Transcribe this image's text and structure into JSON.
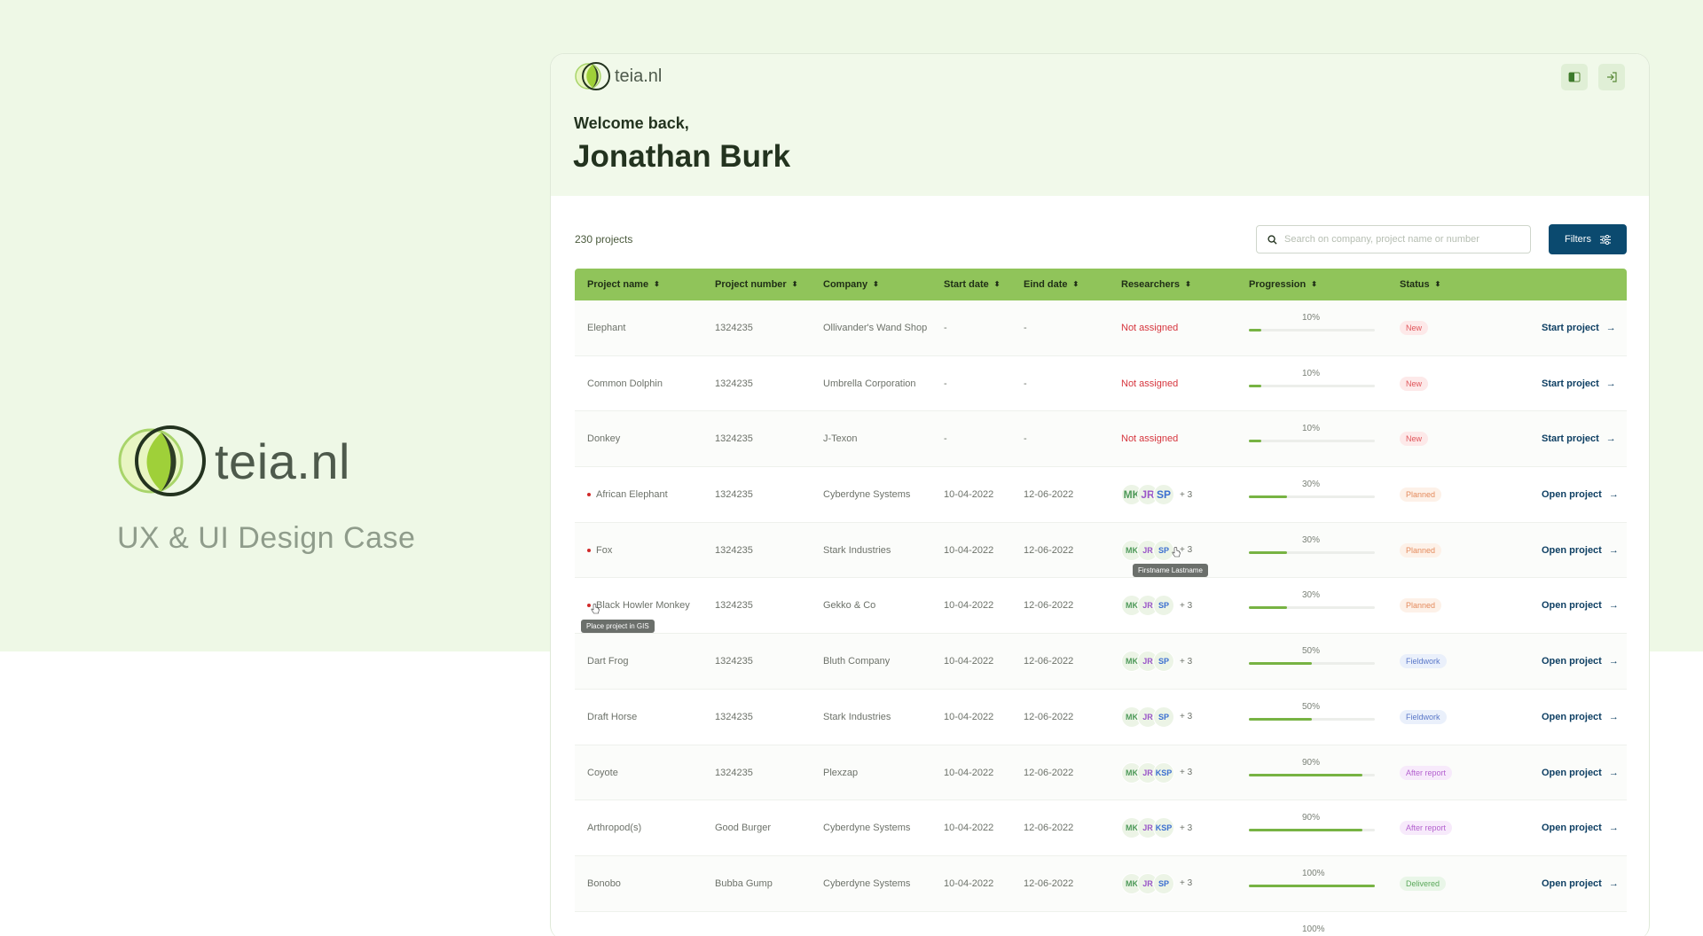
{
  "brand": {
    "name": "teia.nl",
    "subtitle": "UX & UI Design Case"
  },
  "app": {
    "logo_text": "teia.nl",
    "welcome": "Welcome back,",
    "user_name": "Jonathan Burk",
    "project_count": "230 projects",
    "search": {
      "placeholder": "Search on company, project name or number"
    },
    "filters_label": "Filters",
    "colors": {
      "header_bg": "#90c45a",
      "primary_button": "#0b4a6f",
      "progress": "#77b343",
      "not_assigned": "#d6353d"
    }
  },
  "table": {
    "columns": [
      "Project name",
      "Project number",
      "Company",
      "Start date",
      "Eind date",
      "Researchers",
      "Progression",
      "Status"
    ],
    "rows": [
      {
        "name": "Elephant",
        "number": "1324235",
        "company": "Ollivander's Wand Shop",
        "start": "-",
        "end": "-",
        "researchers": "Not assigned",
        "progress_label": "10%",
        "progress": 0.1,
        "status": "New",
        "status_type": "new",
        "action": "Start project",
        "dot": false
      },
      {
        "name": "Common Dolphin",
        "number": "1324235",
        "company": "Umbrella Corporation",
        "start": "-",
        "end": "-",
        "researchers": "Not assigned",
        "progress_label": "10%",
        "progress": 0.1,
        "status": "New",
        "status_type": "new",
        "action": "Start project",
        "dot": false
      },
      {
        "name": "Donkey",
        "number": "1324235",
        "company": "J-Texon",
        "start": "-",
        "end": "-",
        "researchers": "Not assigned",
        "progress_label": "10%",
        "progress": 0.1,
        "status": "New",
        "status_type": "new",
        "action": "Start project",
        "dot": false
      },
      {
        "name": "African Elephant",
        "number": "1324235",
        "company": "Cyberdyne Systems",
        "start": "10-04-2022",
        "end": "12-06-2022",
        "avatars": [
          "MK",
          "JR",
          "SP"
        ],
        "more": "+ 3",
        "progress_label": "30%",
        "progress": 0.3,
        "status": "Planned",
        "status_type": "planned",
        "action": "Open project",
        "dot": true
      },
      {
        "name": "Fox",
        "number": "1324235",
        "company": "Stark Industries",
        "start": "10-04-2022",
        "end": "12-06-2022",
        "avatars": [
          "MK",
          "JR",
          "SP"
        ],
        "more": "+ 3",
        "progress_label": "30%",
        "progress": 0.3,
        "status": "Planned",
        "status_type": "planned",
        "action": "Open project",
        "dot": true
      },
      {
        "name": "Black Howler Monkey",
        "number": "1324235",
        "company": "Gekko & Co",
        "start": "10-04-2022",
        "end": "12-06-2022",
        "avatars": [
          "MK",
          "JR",
          "SP"
        ],
        "more": "+ 3",
        "progress_label": "30%",
        "progress": 0.3,
        "status": "Planned",
        "status_type": "planned",
        "action": "Open project",
        "dot": true
      },
      {
        "name": "Dart Frog",
        "number": "1324235",
        "company": "Bluth Company",
        "start": "10-04-2022",
        "end": "12-06-2022",
        "avatars": [
          "MK",
          "JR",
          "SP"
        ],
        "more": "+ 3",
        "progress_label": "50%",
        "progress": 0.5,
        "status": "Fieldwork",
        "status_type": "fieldwork",
        "action": "Open project",
        "dot": false
      },
      {
        "name": "Draft Horse",
        "number": "1324235",
        "company": "Stark Industries",
        "start": "10-04-2022",
        "end": "12-06-2022",
        "avatars": [
          "MK",
          "JR",
          "SP"
        ],
        "more": "+ 3",
        "progress_label": "50%",
        "progress": 0.5,
        "status": "Fieldwork",
        "status_type": "fieldwork",
        "action": "Open project",
        "dot": false
      },
      {
        "name": "Coyote",
        "number": "1324235",
        "company": "Plexzap",
        "start": "10-04-2022",
        "end": "12-06-2022",
        "avatars": [
          "MK",
          "JR",
          "KSP"
        ],
        "more": "+ 3",
        "progress_label": "90%",
        "progress": 0.9,
        "status": "After report",
        "status_type": "after",
        "action": "Open project",
        "dot": false
      },
      {
        "name": "Arthropod(s)",
        "number": "Good Burger",
        "company": "Cyberdyne Systems",
        "start": "10-04-2022",
        "end": "12-06-2022",
        "avatars": [
          "MK",
          "JR",
          "KSP"
        ],
        "more": "+ 3",
        "progress_label": "90%",
        "progress": 0.9,
        "status": "After report",
        "status_type": "after",
        "action": "Open project",
        "dot": false
      },
      {
        "name": "Bonobo",
        "number": "Bubba Gump",
        "company": "Cyberdyne Systems",
        "start": "10-04-2022",
        "end": "12-06-2022",
        "avatars": [
          "MK",
          "JR",
          "SP"
        ],
        "more": "+ 3",
        "progress_label": "100%",
        "progress": 1.0,
        "status": "Delivered",
        "status_type": "delivered",
        "action": "Open project",
        "dot": false
      }
    ],
    "partial_row": {
      "progress_label": "100%"
    }
  },
  "tooltips": {
    "researcher": "Firstname Lastname",
    "gis": "Place project in GIS"
  }
}
